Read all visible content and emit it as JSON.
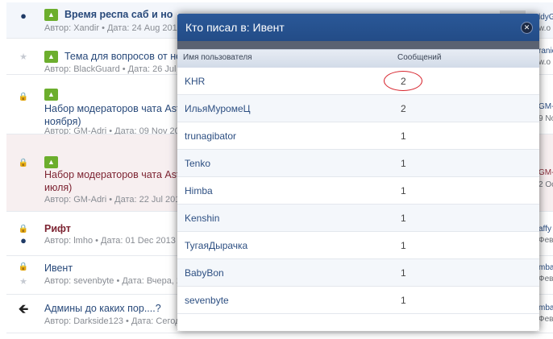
{
  "forum": {
    "threads": [
      {
        "title": "Время респа саб и но",
        "meta_author_label": "Автор:",
        "author": "Xandir",
        "meta_date_label": "• Дата: 24 Aug 2013"
      },
      {
        "title": "Тема для вопросов от но",
        "meta_author_label": "Автор:",
        "author": "BlackGuard",
        "meta_date_label": "• Дата: 26 Jul 2"
      },
      {
        "title_line1": "Набор модераторов чата Ast",
        "title_line2": "ноября)",
        "meta_author_label": "Автор:",
        "author": "GM-Adri",
        "meta_date_label": "• Дата: 09 Nov 20"
      },
      {
        "title_line1": "Набор модераторов чата Ast",
        "title_line2": "июля)",
        "meta_author_label": "Автор:",
        "author": "GM-Adri",
        "meta_date_label": "• Дата: 22 Jul 201"
      },
      {
        "title": "Рифт",
        "meta_author_label": "Автор:",
        "author": "lmho",
        "meta_date_label": "• Дата: 01 Dec 2013"
      },
      {
        "title": "Ивент",
        "meta_author_label": "Автор:",
        "author": "sevenbyte",
        "meta_date_label": "• Дата: Вчера, 2"
      },
      {
        "title": "Админы до каких пор....?",
        "meta_author_label": "Автор:",
        "author": "Darkside123",
        "meta_date_label": "• Дата: Сегод"
      }
    ],
    "side_snippets": [
      "ldyG",
      "w.o",
      "ranic",
      "w.o",
      "GM-A",
      "9 No",
      "GM-A",
      "2 Oc",
      "affy",
      "Фев",
      "mba",
      "Фев",
      "mba",
      "Фев"
    ],
    "up_badge": "▲"
  },
  "modal": {
    "title": "Кто писал в: Ивент",
    "close_icon": "✕",
    "columns": {
      "user": "Имя пользователя",
      "posts": "Сообщений"
    },
    "rows": [
      {
        "user": "KHR",
        "posts": "2"
      },
      {
        "user": "ИльяМуромеЦ",
        "posts": "2"
      },
      {
        "user": "trunagibator",
        "posts": "1"
      },
      {
        "user": "Tenko",
        "posts": "1"
      },
      {
        "user": "Himba",
        "posts": "1"
      },
      {
        "user": "Kenshin",
        "posts": "1"
      },
      {
        "user": "ТугаяДырачка",
        "posts": "1"
      },
      {
        "user": "BabyBon",
        "posts": "1"
      },
      {
        "user": "sevenbyte",
        "posts": "1"
      }
    ]
  },
  "colors": {
    "header": "#2a5898",
    "link": "#2d4f82",
    "annotation_circle": "#d7262f"
  }
}
